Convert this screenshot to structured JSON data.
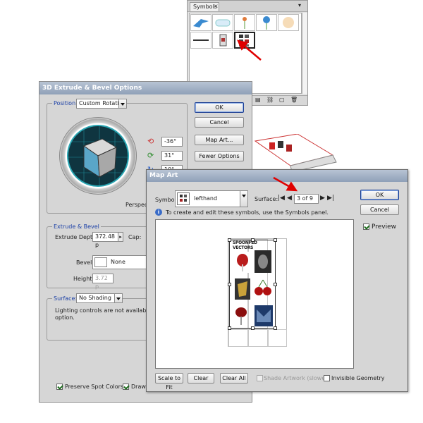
{
  "symbols_panel": {
    "tab_label": "Symbols",
    "symbol_items": [
      "bird-symbol",
      "cloud-symbol",
      "flower-symbol",
      "blue-flower-symbol",
      "sun-symbol",
      "grass-symbol",
      "text-symbol",
      "poster-symbol",
      "lefthand-symbol"
    ]
  },
  "extrude_dialog": {
    "title": "3D Extrude & Bevel Options",
    "position_label": "Position:",
    "position_value": "Custom Rotation",
    "angle_x": "-36°",
    "angle_y": "31°",
    "angle_z": "10°",
    "perspective_label": "Perspecti",
    "ok_label": "OK",
    "cancel_label": "Cancel",
    "map_art_label": "Map Art...",
    "fewer_options_label": "Fewer Options",
    "extrude_bevel_label": "Extrude & Bevel",
    "extrude_depth_label": "Extrude Depth:",
    "extrude_depth_value": "372.48 p",
    "cap_label": "Cap:",
    "bevel_label": "Bevel:",
    "bevel_value": "None",
    "height_label": "Height:",
    "height_value": "3.72 p",
    "surface_label": "Surface:",
    "surface_value": "No Shading",
    "lighting_note_1": "Lighting controls are not available for thi",
    "lighting_note_2": "option.",
    "preserve_spot_label": "Preserve Spot Colors",
    "draw_hidden_label": "Draw H"
  },
  "map_art_dialog": {
    "title": "Map Art",
    "symbol_label": "Symbol:",
    "symbol_value": "lefthand",
    "surface_label": "Surface:",
    "surface_value": "3 of 9",
    "info_text": "To create and edit these symbols, use the Symbols panel.",
    "ok_label": "OK",
    "cancel_label": "Cancel",
    "preview_label": "Preview",
    "art_heading": "SPOONFED VECTORS",
    "scale_to_fit_label": "Scale to Fit",
    "clear_label": "Clear",
    "clear_all_label": "Clear All",
    "shade_artwork_label": "Shade Artwork (slower)",
    "invisible_geometry_label": "Invisible Geometry"
  }
}
